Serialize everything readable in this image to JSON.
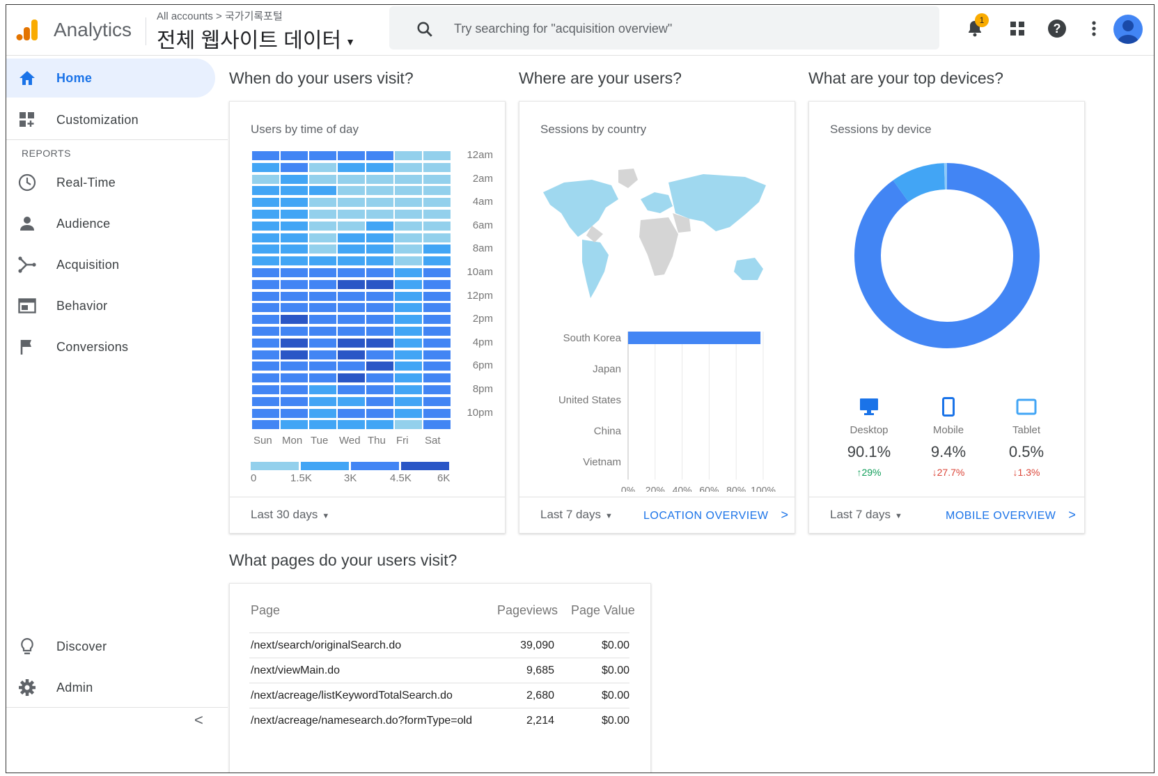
{
  "header": {
    "brand": "Analytics",
    "breadcrumb": "All accounts > 국가기록포털",
    "property": "전체 웹사이트 데이터",
    "search_placeholder": "Try searching for \"acquisition overview\"",
    "notification_count": "1"
  },
  "sidebar": {
    "home": "Home",
    "customization": "Customization",
    "reports_heading": "REPORTS",
    "items": [
      "Real-Time",
      "Audience",
      "Acquisition",
      "Behavior",
      "Conversions"
    ],
    "discover": "Discover",
    "admin": "Admin"
  },
  "sections": {
    "when": "When do your users visit?",
    "where": "Where are your users?",
    "devices": "What are your top devices?",
    "pages": "What pages do your users visit?"
  },
  "time_card": {
    "title": "Users by time of day",
    "range": "Last 30 days",
    "days": [
      "Sun",
      "Mon",
      "Tue",
      "Wed",
      "Thu",
      "Fri",
      "Sat"
    ],
    "hours": [
      "12am",
      "2am",
      "4am",
      "6am",
      "8am",
      "10am",
      "12pm",
      "2pm",
      "4pm",
      "6pm",
      "8pm",
      "10pm"
    ],
    "legend": [
      "0",
      "1.5K",
      "3K",
      "4.5K",
      "6K"
    ],
    "legend_colors": [
      "#93d0ec",
      "#42a5f5",
      "#4285f4",
      "#2a56c6"
    ],
    "intensity": [
      [
        2,
        2,
        2,
        2,
        2,
        0,
        0
      ],
      [
        1,
        2,
        0,
        1,
        1,
        0,
        0
      ],
      [
        0,
        1,
        0,
        0,
        0,
        0,
        0
      ],
      [
        1,
        1,
        1,
        0,
        0,
        0,
        0
      ],
      [
        1,
        1,
        0,
        0,
        0,
        0,
        0
      ],
      [
        1,
        1,
        0,
        0,
        0,
        0,
        0
      ],
      [
        1,
        1,
        0,
        0,
        1,
        0,
        0
      ],
      [
        1,
        1,
        0,
        1,
        1,
        0,
        0
      ],
      [
        1,
        1,
        0,
        1,
        1,
        0,
        1
      ],
      [
        1,
        1,
        1,
        1,
        1,
        0,
        1
      ],
      [
        2,
        2,
        2,
        2,
        2,
        1,
        2
      ],
      [
        2,
        2,
        2,
        3,
        3,
        1,
        2
      ],
      [
        2,
        2,
        2,
        2,
        2,
        1,
        2
      ],
      [
        2,
        2,
        2,
        2,
        2,
        1,
        2
      ],
      [
        2,
        3,
        2,
        2,
        2,
        1,
        2
      ],
      [
        2,
        2,
        2,
        2,
        2,
        1,
        2
      ],
      [
        2,
        3,
        2,
        3,
        3,
        1,
        2
      ],
      [
        2,
        3,
        2,
        3,
        2,
        1,
        2
      ],
      [
        2,
        2,
        2,
        2,
        3,
        1,
        2
      ],
      [
        2,
        2,
        2,
        3,
        2,
        1,
        2
      ],
      [
        2,
        2,
        1,
        2,
        2,
        1,
        2
      ],
      [
        2,
        2,
        1,
        1,
        2,
        1,
        2
      ],
      [
        2,
        2,
        1,
        2,
        2,
        1,
        2
      ],
      [
        2,
        1,
        1,
        1,
        1,
        0,
        2
      ]
    ]
  },
  "country_card": {
    "title": "Sessions by country",
    "range": "Last 7 days",
    "link": "LOCATION OVERVIEW",
    "countries": [
      "South Korea",
      "Japan",
      "United States",
      "China",
      "Vietnam"
    ],
    "shares": [
      0.98,
      0.0,
      0.0,
      0.0,
      0.0
    ],
    "pct_ticks": [
      "0%",
      "20%",
      "40%",
      "60%",
      "80%",
      "100%"
    ]
  },
  "device_card": {
    "title": "Sessions by device",
    "range": "Last 7 days",
    "link": "MOBILE OVERVIEW",
    "devices": [
      {
        "name": "Desktop",
        "value": "90.1%",
        "change": "↑29%",
        "dir": "up"
      },
      {
        "name": "Mobile",
        "value": "9.4%",
        "change": "↓27.7%",
        "dir": "down"
      },
      {
        "name": "Tablet",
        "value": "0.5%",
        "change": "↓1.3%",
        "dir": "down"
      }
    ],
    "shares": [
      90.1,
      9.4,
      0.5
    ],
    "colors": [
      "#4285f4",
      "#42a5f5",
      "#90caf9"
    ]
  },
  "pages_card": {
    "headers": [
      "Page",
      "Pageviews",
      "Page Value"
    ],
    "rows": [
      [
        "/next/search/originalSearch.do",
        "39,090",
        "$0.00"
      ],
      [
        "/next/viewMain.do",
        "9,685",
        "$0.00"
      ],
      [
        "/next/acreage/listKeywordTotalSearch.do",
        "2,680",
        "$0.00"
      ],
      [
        "/next/acreage/namesearch.do?formType=old",
        "2,214",
        "$0.00"
      ]
    ]
  }
}
